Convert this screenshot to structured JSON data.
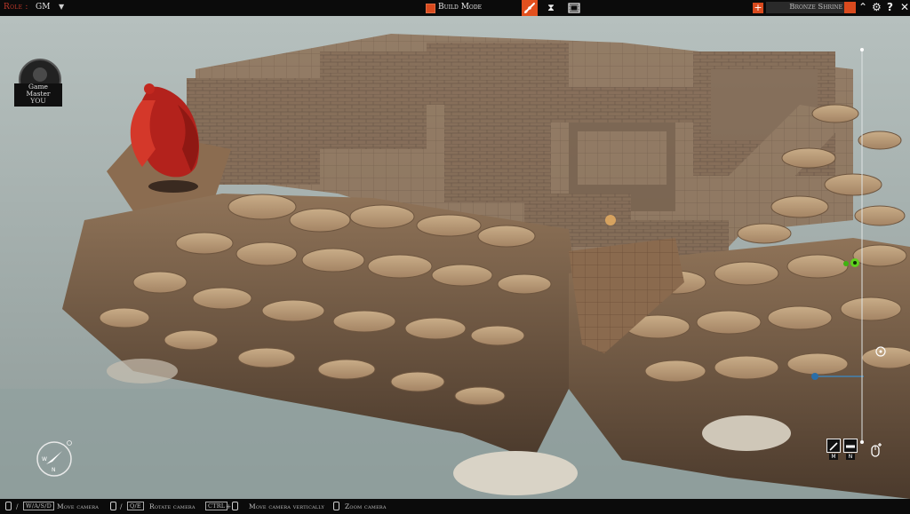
{
  "topbar": {
    "role_label": "Role :",
    "role_value": "GM",
    "build_mode_label": "Build Mode",
    "location_name": "Bronze Shrine"
  },
  "avatar": {
    "line1": "Game",
    "line2": "Master",
    "line3": "YOU"
  },
  "bottombar": {
    "keys_wasd": "W/A/S/D",
    "move_camera": "Move camera",
    "keys_qe": "Q/E",
    "rotate_camera": "Rotate camera",
    "key_ctrl": "CTRL",
    "plus": "+",
    "move_camera_vertically": "Move camera vertically",
    "zoom_camera": "Zoom camera",
    "slash1": "/",
    "slash2": "/"
  },
  "side_controls": {
    "line_key": "M",
    "wall_key": "N"
  },
  "colors": {
    "accent": "#d94a1e",
    "bar_bg": "#0b0b0b",
    "fog": "#a9b3b1",
    "rock": "#b89874",
    "brick": "#7a5a40"
  }
}
